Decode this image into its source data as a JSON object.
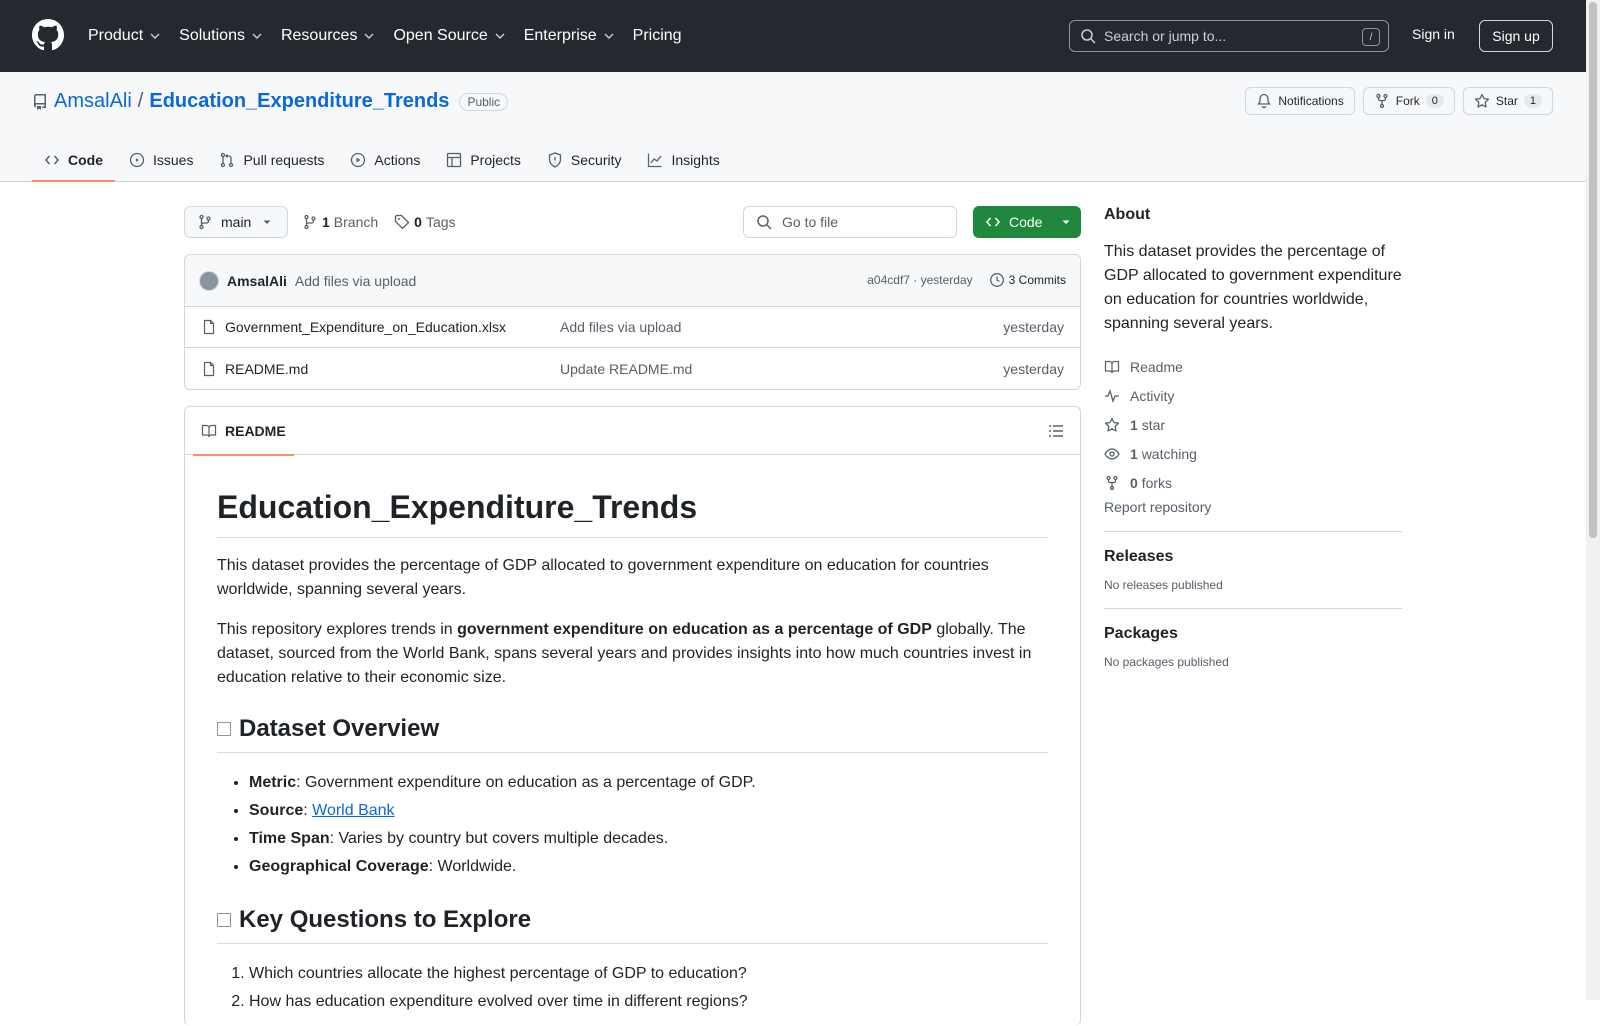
{
  "topnav": {
    "items": [
      {
        "label": "Product",
        "has_dropdown": true
      },
      {
        "label": "Solutions",
        "has_dropdown": true
      },
      {
        "label": "Resources",
        "has_dropdown": true
      },
      {
        "label": "Open Source",
        "has_dropdown": true
      },
      {
        "label": "Enterprise",
        "has_dropdown": true
      },
      {
        "label": "Pricing",
        "has_dropdown": false
      }
    ],
    "search_placeholder": "Search or jump to...",
    "search_shortcut": "/",
    "sign_in": "Sign in",
    "sign_up": "Sign up"
  },
  "repo": {
    "owner": "AmsalAli",
    "separator": "/",
    "name": "Education_Expenditure_Trends",
    "visibility": "Public",
    "notifications_label": "Notifications",
    "fork_label": "Fork",
    "fork_count": "0",
    "star_label": "Star",
    "star_count": "1"
  },
  "tabs": [
    {
      "label": "Code",
      "icon": "code-icon",
      "active": true
    },
    {
      "label": "Issues",
      "icon": "issue-icon",
      "active": false
    },
    {
      "label": "Pull requests",
      "icon": "pull-request-icon",
      "active": false
    },
    {
      "label": "Actions",
      "icon": "play-icon",
      "active": false
    },
    {
      "label": "Projects",
      "icon": "table-icon",
      "active": false
    },
    {
      "label": "Security",
      "icon": "shield-icon",
      "active": false
    },
    {
      "label": "Insights",
      "icon": "graph-icon",
      "active": false
    }
  ],
  "toolbar": {
    "branch": "main",
    "branch_count": "1",
    "branch_label": "Branch",
    "tag_count": "0",
    "tag_label": "Tags",
    "goto_placeholder": "Go to file",
    "code_button": "Code"
  },
  "latest_commit": {
    "author": "AmsalAli",
    "message": "Add files via upload",
    "hash_time": "a04cdf7 · yesterday",
    "commits": "3 Commits"
  },
  "files": [
    {
      "name": "Government_Expenditure_on_Education.xlsx",
      "message": "Add files via upload",
      "date": "yesterday"
    },
    {
      "name": "README.md",
      "message": "Update README.md",
      "date": "yesterday"
    }
  ],
  "readme": {
    "tab_label": "README",
    "title": "Education_Expenditure_Trends",
    "intro": "This dataset provides the percentage of GDP allocated to government expenditure on education for countries worldwide, spanning several years.",
    "p2_before": "This repository explores trends in ",
    "p2_bold": "government expenditure on education as a percentage of GDP",
    "p2_after": " globally. The dataset, sourced from the World Bank, spans several years and provides insights into how much countries invest in education relative to their economic size.",
    "overview_heading": "Dataset Overview",
    "overview": [
      {
        "key": "Metric",
        "value": ": Government expenditure on education as a percentage of GDP.",
        "link": ""
      },
      {
        "key": "Source",
        "value": ": ",
        "link": "World Bank"
      },
      {
        "key": "Time Span",
        "value": ": Varies by country but covers multiple decades.",
        "link": ""
      },
      {
        "key": "Geographical Coverage",
        "value": ": Worldwide.",
        "link": ""
      }
    ],
    "questions_heading": "Key Questions to Explore",
    "questions": [
      "Which countries allocate the highest percentage of GDP to education?",
      "How has education expenditure evolved over time in different regions?"
    ]
  },
  "about": {
    "heading": "About",
    "description": "This dataset provides the percentage of GDP allocated to government expenditure on education for countries worldwide, spanning several years.",
    "items": [
      {
        "icon": "book-icon",
        "count": "",
        "label": "Readme"
      },
      {
        "icon": "pulse-icon",
        "count": "",
        "label": "Activity"
      },
      {
        "icon": "star-icon",
        "count": "1",
        "label": "star"
      },
      {
        "icon": "eye-icon",
        "count": "1",
        "label": "watching"
      },
      {
        "icon": "fork-icon",
        "count": "0",
        "label": "forks"
      }
    ],
    "report": "Report repository"
  },
  "releases": {
    "heading": "Releases",
    "text": "No releases published"
  },
  "packages": {
    "heading": "Packages",
    "text": "No packages published"
  },
  "colors": {
    "header_bg": "#24292f",
    "link": "#0969da",
    "code_button": "#1f883d",
    "tab_underline": "#fd8c73"
  }
}
